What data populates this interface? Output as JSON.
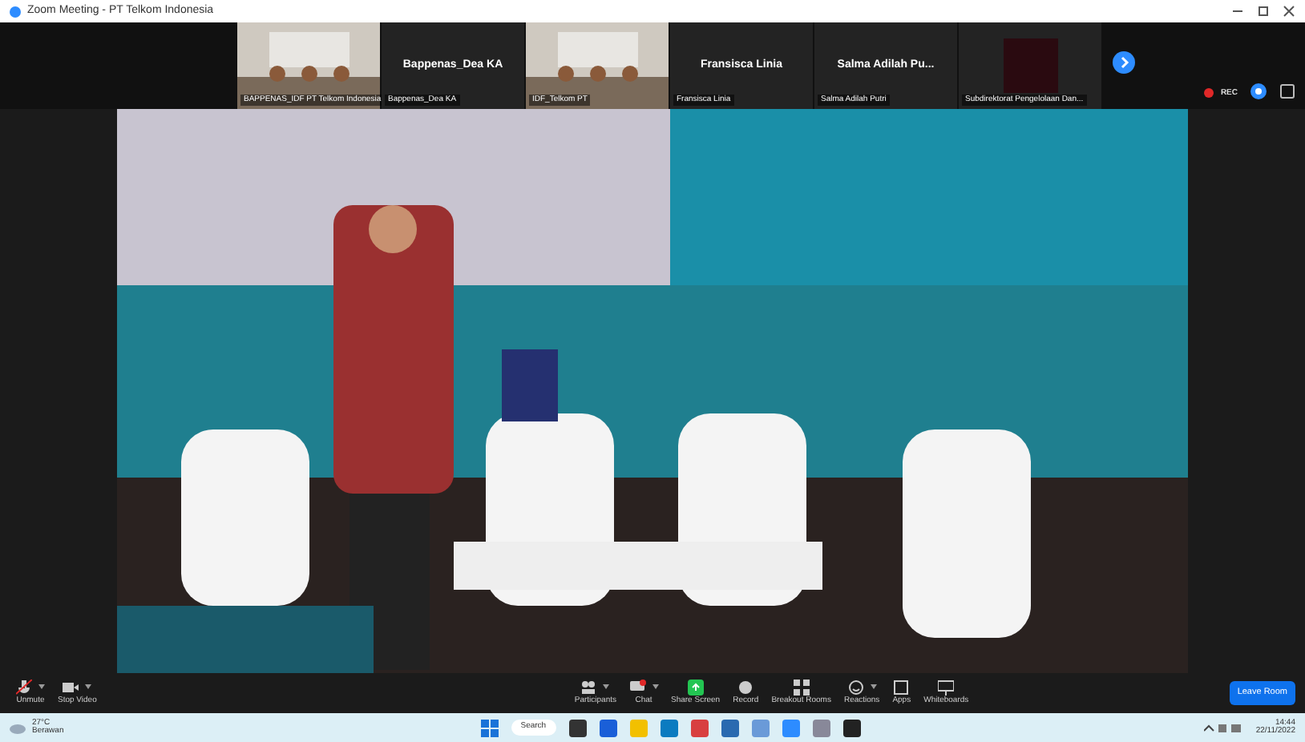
{
  "window": {
    "title": "Zoom Meeting - PT Telkom Indonesia"
  },
  "tiles": [
    {
      "kind": "video",
      "label": "BAPPENAS_IDF PT Telkom Indonesia"
    },
    {
      "kind": "name",
      "name": "Bappenas_Dea KA",
      "label": "Bappenas_Dea KA"
    },
    {
      "kind": "video",
      "label": "IDF_Telkom PT"
    },
    {
      "kind": "name",
      "name": "Fransisca Linia",
      "label": "Fransisca Linia"
    },
    {
      "kind": "name",
      "name": "Salma Adilah  Pu...",
      "label": "Salma Adilah Putri"
    },
    {
      "kind": "dark",
      "label": "Subdirektorat Pengelolaan Dan..."
    }
  ],
  "recording": {
    "label": "REC"
  },
  "toolbar": [
    {
      "label": "Unmute",
      "kind": "mic",
      "caret": true
    },
    {
      "label": "Stop Video",
      "kind": "video",
      "caret": true
    },
    {
      "label": "Participants",
      "kind": "people",
      "caret": true
    },
    {
      "label": "Chat",
      "kind": "chat",
      "caret": true
    },
    {
      "label": "Share Screen",
      "kind": "share",
      "caret": false
    },
    {
      "label": "Record",
      "kind": "record",
      "caret": false
    },
    {
      "label": "Breakout Rooms",
      "kind": "grid",
      "caret": false
    },
    {
      "label": "Reactions",
      "kind": "smile",
      "caret": true
    },
    {
      "label": "Apps",
      "kind": "apps",
      "caret": false
    },
    {
      "label": "Whiteboards",
      "kind": "board",
      "caret": false
    }
  ],
  "leave_button": "Leave Room",
  "taskbar": {
    "weather_temp": "27°C",
    "weather_text": "Berawan",
    "search": "Search",
    "time": "14:44",
    "date": "22/11/2022"
  }
}
